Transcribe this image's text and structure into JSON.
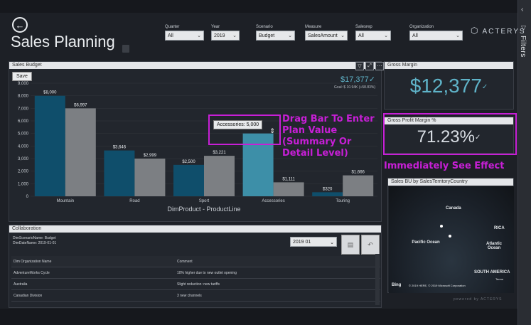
{
  "app": {
    "title": "Sales Planning",
    "logo_text": "ACTERYS",
    "powered_by": "powered by ACTERYS",
    "filters_label": "Filters"
  },
  "slicers": [
    {
      "label": "Quarter",
      "value": "All"
    },
    {
      "label": "Year",
      "value": "2019"
    },
    {
      "label": "Scenario",
      "value": "Budget"
    },
    {
      "label": "Measure",
      "value": "SalesAmount"
    },
    {
      "label": "Salesrep",
      "value": "All"
    },
    {
      "label": "Organization",
      "value": "All"
    }
  ],
  "sales_budget": {
    "header": "Sales Budget",
    "save_label": "Save",
    "total": "$17,377",
    "subtitle": "Goal: $ 10.94K (+58.83%)",
    "x_title": "DimProduct - ProductLine",
    "tooltip_label": "Accessories:",
    "tooltip_value": "5,000"
  },
  "chart_data": {
    "type": "bar",
    "title": "Sales Budget",
    "xlabel": "DimProduct - ProductLine",
    "ylabel": "",
    "ylim": [
      0,
      9000
    ],
    "y_ticks": [
      "0",
      "1,000",
      "2,000",
      "3,000",
      "4,000",
      "5,000",
      "6,000",
      "7,000",
      "8,000",
      "9,000"
    ],
    "categories": [
      "Mountain",
      "Road",
      "Sport",
      "Accessories",
      "Touring"
    ],
    "series": [
      {
        "values": [
          8000,
          3646,
          2500,
          5000,
          320
        ],
        "labels": [
          "$8,000",
          "$3,646",
          "$2,500",
          "",
          "$320"
        ],
        "color": "#0f4e6b"
      },
      {
        "values": [
          6997,
          2999,
          3221,
          1111,
          1666
        ],
        "labels": [
          "$6,997",
          "$2,999",
          "$3,221",
          "$1,111",
          "$1,666"
        ],
        "color": "#7c7f83"
      }
    ]
  },
  "gross_margin": {
    "header": "Gross Margin",
    "value": "$12,377"
  },
  "gross_profit_margin": {
    "header": "Gross Profit Margin %",
    "value": "71.23%"
  },
  "annotations": {
    "drag": "Drag Bar To Enter Plan Value (Summary Or Detail Level)",
    "effect": "Immediately See Effect"
  },
  "map": {
    "header": "Sales BU by SalesTerritoryCountry",
    "labels": [
      {
        "text": "Canada"
      },
      {
        "text": "RICA"
      },
      {
        "text": "Pacific Ocean"
      },
      {
        "text": "Atlantic Ocean"
      },
      {
        "text": "SOUTH AMERICA"
      },
      {
        "text": "Bing"
      },
      {
        "text": "© 2019 HERE, © 2019 Microsoft Corporation"
      },
      {
        "text": "Terms"
      }
    ]
  },
  "collaboration": {
    "header": "Collaboration",
    "meta_line1": "DimScenarioName: Budget",
    "meta_line2": "DimDateName: 2019-01-01",
    "period": "2019 01",
    "col1": "Dim Organization Name",
    "col2": "Comment",
    "rows": [
      {
        "org": "AdventureWorks Cycle",
        "comment": "10% higher due to new outlet opening"
      },
      {
        "org": "Australia",
        "comment": "Slight reduction: new tariffs"
      },
      {
        "org": "Canadian Division",
        "comment": "3 new channels"
      }
    ]
  }
}
